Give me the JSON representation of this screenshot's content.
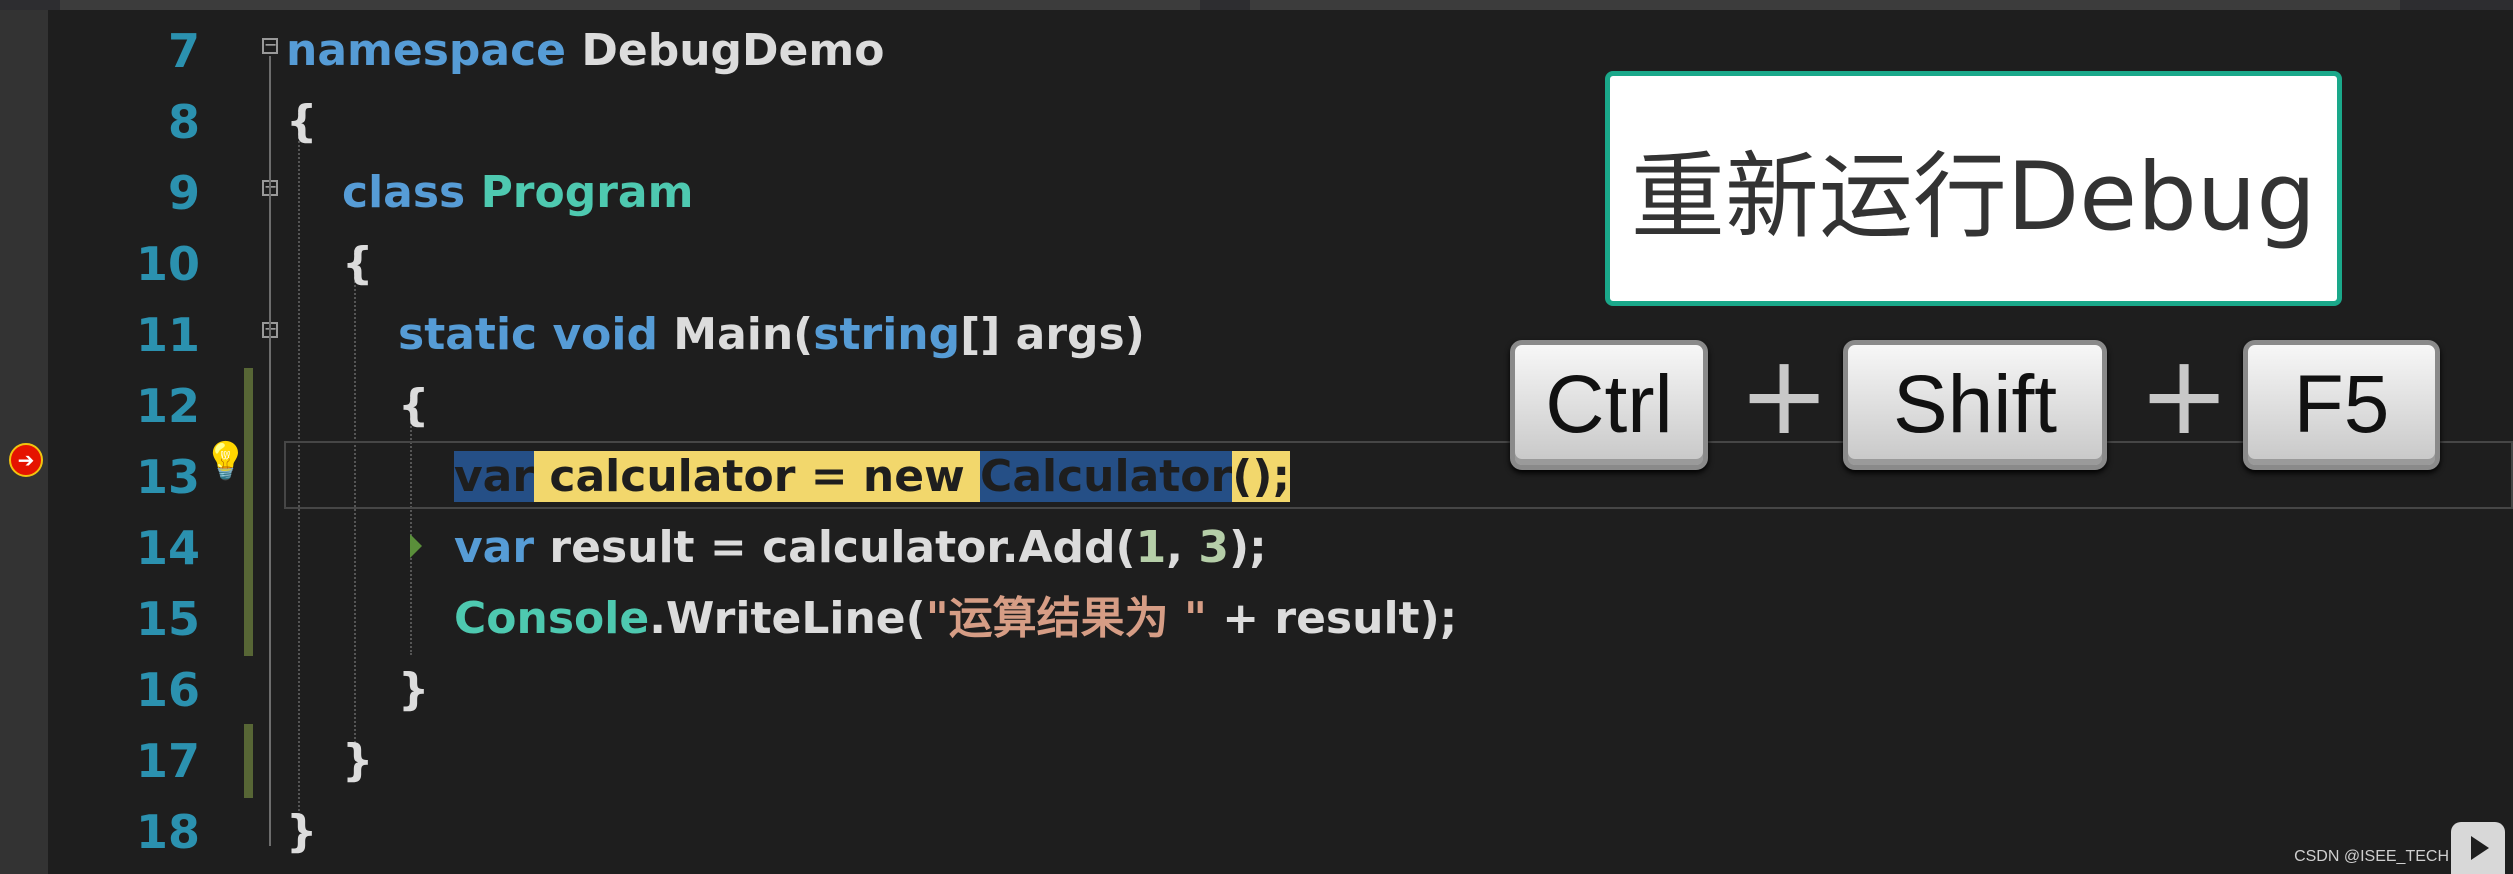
{
  "line_numbers": [
    "7",
    "8",
    "9",
    "10",
    "11",
    "12",
    "13",
    "14",
    "15",
    "16",
    "17",
    "18"
  ],
  "code": {
    "l7_kw": "namespace",
    "l7_name": "DebugDemo",
    "open_brace": "{",
    "close_brace": "}",
    "l9_kw": "class",
    "l9_name": "Program",
    "l11_static": "static",
    "l11_void": "void",
    "l11_main": "Main(",
    "l11_string": "string",
    "l11_rest": "[] args)",
    "l13_var": "var",
    "l13_mid": " calculator = new ",
    "l13_type": "Calculator",
    "l13_end": "();",
    "l14_var": "var",
    "l14_mid": " result = calculator.Add(",
    "l14_num1": "1",
    "l14_comma": ", ",
    "l14_num2": "3",
    "l14_end": ");",
    "l15_type": "Console",
    "l15_mid": ".WriteLine(",
    "l15_str": "\"运算结果为 \"",
    "l15_end": " + result);"
  },
  "overlay": {
    "caption": "重新运行Debug",
    "keys": [
      "Ctrl",
      "Shift",
      "F5"
    ],
    "plus": "+"
  },
  "watermark": "CSDN @ISEE_TECH",
  "icons": {
    "breakpoint": "current-statement-arrow-icon",
    "lightbulb": "lightbulb-icon",
    "fold": "collapse-icon",
    "logo": "video-logo-icon"
  },
  "colors": {
    "background": "#1e1e1e",
    "keyword": "#569cd6",
    "type": "#4ec9b0",
    "string": "#d69d85",
    "number": "#b5cea8",
    "line_number": "#2b91af",
    "highlight": "#f2d76c",
    "caption_border": "#1aa88a"
  }
}
